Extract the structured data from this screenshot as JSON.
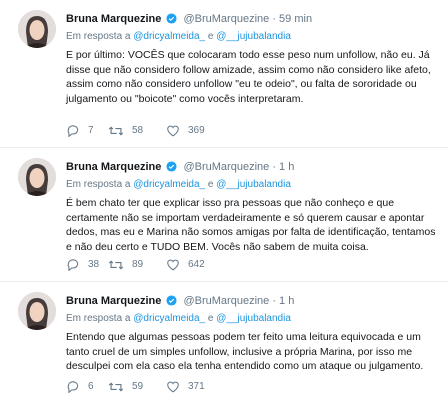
{
  "tweets": [
    {
      "name": "Bruna Marquezine",
      "handle": "@BruMarquezine",
      "dot": "·",
      "time": "59 min",
      "reply_prefix": "Em resposta a",
      "mention1": "@dricyalmeida_",
      "and_word": "e",
      "mention2": "@__jujubalandia",
      "text": "E por último: VOCÊS que colocaram todo esse peso num unfollow, não eu. Já disse que não considero follow amizade, assim como não considero like afeto, assim como não considero unfollow \"eu te odeio\", ou falta de sororidade ou julgamento ou \"boicote\" como vocês interpretaram.",
      "replies": "7",
      "retweets": "58",
      "likes": "369"
    },
    {
      "name": "Bruna Marquezine",
      "handle": "@BruMarquezine",
      "dot": "·",
      "time": "1 h",
      "reply_prefix": "Em resposta a",
      "mention1": "@dricyalmeida_",
      "and_word": "e",
      "mention2": "@__jujubalandia",
      "text": "É bem chato ter que explicar isso pra pessoas que não conheço e que certamente não se importam verdadeiramente e só querem causar e apontar dedos, mas eu e Marina não somos amigas por falta de identificação, tentamos e não deu certo e TUDO BEM. Vocês não sabem de muita coisa.",
      "replies": "38",
      "retweets": "89",
      "likes": "642"
    },
    {
      "name": "Bruna Marquezine",
      "handle": "@BruMarquezine",
      "dot": "·",
      "time": "1 h",
      "reply_prefix": "Em resposta a",
      "mention1": "@dricyalmeida_",
      "and_word": "e",
      "mention2": "@__jujubalandia",
      "text": "Entendo que algumas pessoas podem ter feito uma leitura equivocada e um tanto cruel de um simples unfollow, inclusive a própria Marina, por isso me desculpei com ela caso ela tenha entendido como um ataque ou julgamento.",
      "replies": "6",
      "retweets": "59",
      "likes": "371"
    }
  ],
  "colors": {
    "link": "#1b95e0",
    "muted": "#657786",
    "verified": "#1da1f2"
  },
  "icons": {
    "reply": "reply-icon",
    "retweet": "retweet-icon",
    "like": "heart-icon",
    "verified": "verified-badge-icon"
  }
}
